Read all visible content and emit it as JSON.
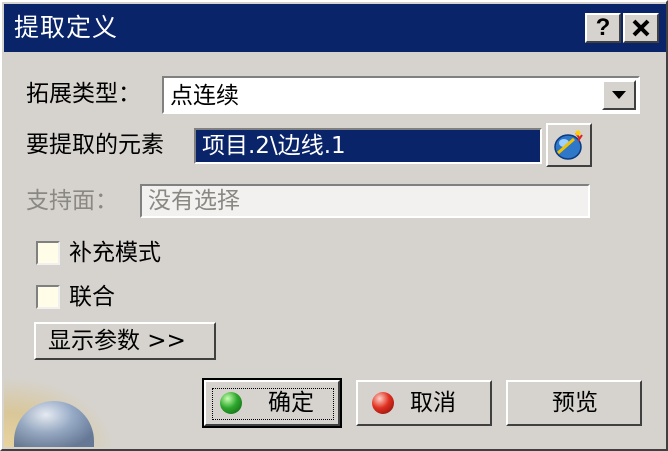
{
  "window": {
    "title": "提取定义",
    "help_button": "?",
    "close_button": "✕"
  },
  "form": {
    "extension_type_label": "拓展类型：",
    "extension_type_value": "点连续",
    "element_label": "要提取的元素",
    "element_value": "项目.2\\边线.1",
    "support_label": "支持面：",
    "support_value": "没有选择",
    "complement_mode_label": "补充模式",
    "federation_label": "联合",
    "show_params_label": "显示参数 >>"
  },
  "buttons": {
    "ok": "确定",
    "cancel": "取消",
    "preview": "预览"
  },
  "icons": {
    "dropdown": "chevron-down-icon",
    "element_selector": "selection-tool-icon",
    "ok": "green-ball-icon",
    "cancel": "red-ball-icon"
  },
  "colors": {
    "titlebar": "#0a246a",
    "selection": "#0a246a",
    "dialog": "#d6d3ce"
  }
}
